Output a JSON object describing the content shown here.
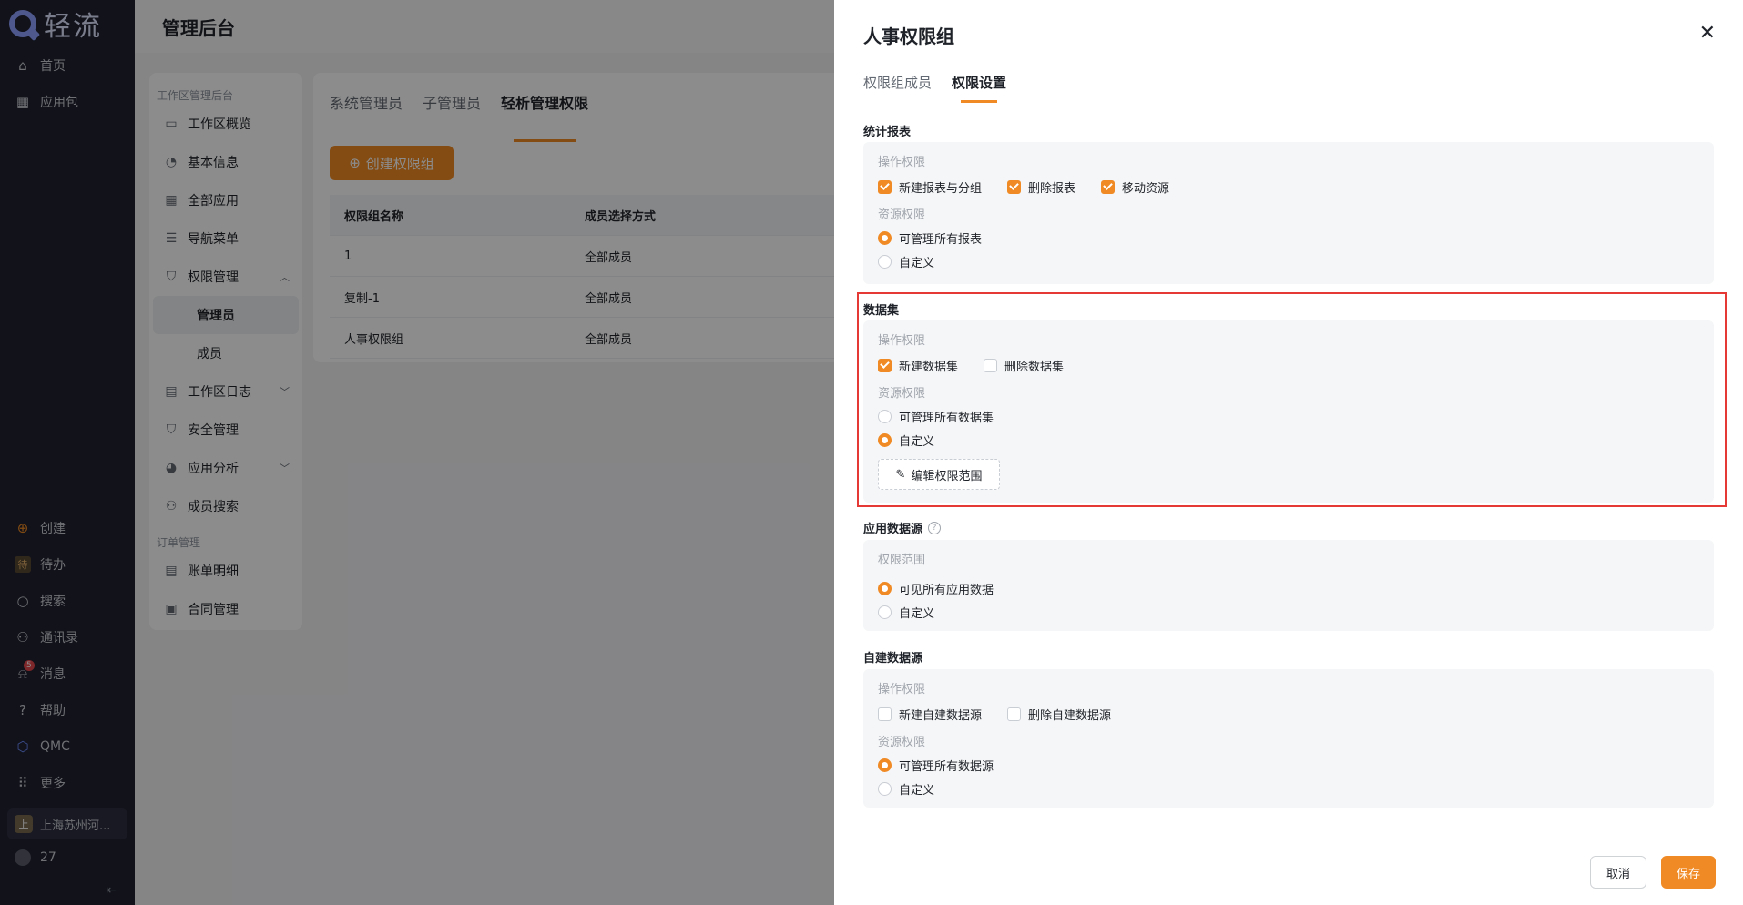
{
  "app": {
    "logo_text": "轻流"
  },
  "leftnav": {
    "top_items": [
      {
        "label": "首页",
        "icon": "home-icon"
      },
      {
        "label": "应用包",
        "icon": "grid-icon"
      }
    ],
    "bottom_items": [
      {
        "label": "创建",
        "icon": "plus-circle-icon"
      },
      {
        "label": "待办",
        "icon": "todo-icon"
      },
      {
        "label": "搜索",
        "icon": "search-icon"
      },
      {
        "label": "通讯录",
        "icon": "contacts-icon"
      },
      {
        "label": "消息",
        "icon": "bell-icon",
        "badge": "5"
      },
      {
        "label": "帮助",
        "icon": "help-icon"
      },
      {
        "label": "QMC",
        "icon": "qmc-icon"
      },
      {
        "label": "更多",
        "icon": "more-grid-icon"
      }
    ],
    "org_label": "上海苏州河...",
    "org_badge": "上",
    "user_label": "27"
  },
  "main": {
    "header_title": "管理后台",
    "subnav": {
      "group1": "工作区管理后台",
      "items": [
        {
          "label": "工作区概览"
        },
        {
          "label": "基本信息"
        },
        {
          "label": "全部应用"
        },
        {
          "label": "导航菜单"
        },
        {
          "label": "权限管理"
        },
        {
          "label": "管理员"
        },
        {
          "label": "成员"
        },
        {
          "label": "工作区日志"
        },
        {
          "label": "安全管理"
        },
        {
          "label": "应用分析"
        },
        {
          "label": "成员搜索"
        }
      ],
      "group2": "订单管理",
      "items2": [
        {
          "label": "账单明细"
        },
        {
          "label": "合同管理"
        }
      ]
    },
    "tabs": [
      "系统管理员",
      "子管理员",
      "轻析管理权限"
    ],
    "create_button": "创建权限组",
    "table": {
      "headers": [
        "权限组名称",
        "成员选择方式"
      ],
      "rows": [
        [
          "1",
          "全部成员"
        ],
        [
          "复制-1",
          "全部成员"
        ],
        [
          "人事权限组",
          "全部成员"
        ]
      ]
    }
  },
  "drawer": {
    "title": "人事权限组",
    "tabs": [
      "权限组成员",
      "权限设置"
    ],
    "sections": {
      "report": {
        "title": "统计报表",
        "op_label": "操作权限",
        "checks": [
          "新建报表与分组",
          "删除报表",
          "移动资源"
        ],
        "res_label": "资源权限",
        "radios": [
          "可管理所有报表",
          "自定义"
        ]
      },
      "dataset": {
        "title": "数据集",
        "op_label": "操作权限",
        "checks": [
          "新建数据集",
          "删除数据集"
        ],
        "res_label": "资源权限",
        "radios": [
          "可管理所有数据集",
          "自定义"
        ],
        "edit_button": "编辑权限范围"
      },
      "appsource": {
        "title": "应用数据源",
        "scope_label": "权限范围",
        "radios": [
          "可见所有应用数据",
          "自定义"
        ]
      },
      "selfsource": {
        "title": "自建数据源",
        "op_label": "操作权限",
        "checks": [
          "新建自建数据源",
          "删除自建数据源"
        ],
        "res_label": "资源权限",
        "radios": [
          "可管理所有数据源",
          "自定义"
        ]
      }
    },
    "cancel_label": "取消",
    "save_label": "保存"
  },
  "colors": {
    "accent": "#f08a24",
    "nav_bg": "#1f2130",
    "highlight": "#e53935"
  }
}
